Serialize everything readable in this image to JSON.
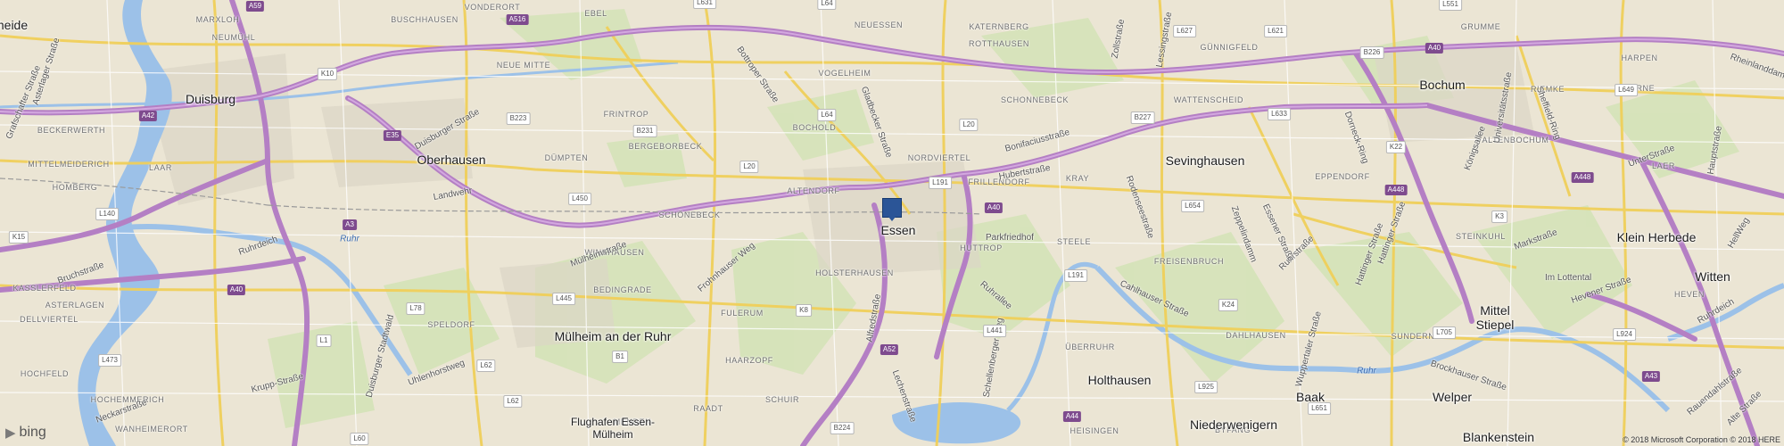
{
  "cities": [
    {
      "id": "duisburg",
      "name": "Duisburg"
    },
    {
      "id": "oberhausen",
      "name": "Oberhausen"
    },
    {
      "id": "essen",
      "name": "Essen"
    },
    {
      "id": "bochum",
      "name": "Bochum"
    },
    {
      "id": "muelheim",
      "name": "Mülheim an der Ruhr"
    },
    {
      "id": "witten",
      "name": "Witten"
    },
    {
      "id": "sevinghausen",
      "name": "Sevinghausen"
    },
    {
      "id": "holthausen",
      "name": "Holthausen"
    },
    {
      "id": "klein-herbede",
      "name": "Klein Herbede"
    },
    {
      "id": "mittel-stiepel",
      "name": "Mittel\nStiepel"
    },
    {
      "id": "welper",
      "name": "Welper"
    },
    {
      "id": "baak",
      "name": "Baak"
    },
    {
      "id": "niederwenigern",
      "name": "Niederwenigern"
    },
    {
      "id": "blankenstein",
      "name": "Blankenstein"
    },
    {
      "id": "flughafen",
      "name": "Flughafen Essen-Mülheim"
    },
    {
      "id": "heide",
      "name": "heide"
    }
  ],
  "districts": [
    "MARXLOH",
    "NEUMÜHL",
    "BUSCHHAUSEN",
    "VONDERORT",
    "EBEL",
    "NEUESSEN",
    "KATERNBERG",
    "ROTTHAUSEN",
    "GÜNNIGFELD",
    "GRUMME",
    "HARPEN",
    "WERNE",
    "NEUE MITTE",
    "VOGELHEIM",
    "SCHONNEBECK",
    "WATTENSCHEID",
    "RIEMKE",
    "BECKERWERTH",
    "FRINTROP",
    "BERGEBORBECK",
    "BOCHOLD",
    "NORDVIERTEL",
    "ALTENBOCHUM",
    "LAAR",
    "MITTELMEIDERICH",
    "DÜMPTEN",
    "ALTENDORF",
    "FRILLENDORF",
    "KRAY",
    "LAER",
    "HOMBERG",
    "SCHÖNEBECK",
    "EPPENDORF",
    "WINKHAUSEN",
    "HOLSTERHAUSEN",
    "HUTTROP",
    "STEELE",
    "KASSLERFELD",
    "STEINKUHL",
    "FREISENBRUCH",
    "ASTERLAGEN",
    "BEDINGRADE",
    "FULERUM",
    "DELLVIERTEL",
    "SPELDORF",
    "DAHLHAUSEN",
    "SUNDERN",
    "HEVEN",
    "HAARZOPF",
    "ÜBERRUHR",
    "HOCHFELD",
    "HOCHEMMERICH",
    "SCHUIR",
    "RAADT",
    "BYFANG",
    "HEISINGEN",
    "WANHEIMERORT",
    "MENDEN"
  ],
  "streets": [
    "Asterlager Straße",
    "Grafschafter Straße",
    "Bottroper Straße",
    "Gladbecker Straße",
    "Duisburger Straße",
    "Frohnhauser Weg",
    "Alfredstraße",
    "Ruhrallee",
    "Rodenseestraße",
    "Zeppelindamm",
    "Ruhrstraße",
    "Hattinger Straße",
    "Cahlhauser Straße",
    "Wuppertaler Straße",
    "Brockhauser Straße",
    "Lechenstraße",
    "Schellenberger Weg",
    "Hubertstraße",
    "Parkfriedhof",
    "Ruhrdeich",
    "Bruchstraße",
    "Landwehr",
    "Mülheimstraße",
    "Duisburger Stadtwald",
    "Uhlenhorstweg",
    "Krupp-Straße",
    "Neckarstraße",
    "Zollstraße",
    "Lessingstraße",
    "Bonifaciusstraße",
    "Essener Straße",
    "Dorneck-Ring",
    "Königsallee",
    "Universitätsstraße",
    "Markstraße",
    "Im Lottental",
    "Sheffield-Ring",
    "Hattinger Straße",
    "UnterStraße",
    "Hauptstraße",
    "HellWeg",
    "Hevener Straße",
    "Ruhrdeich",
    "Rauendahlstraße",
    "Alte Straße",
    "Rheinlanddamm"
  ],
  "shields_hw": [
    "A59",
    "A516",
    "A40",
    "A42",
    "E35",
    "A3",
    "A40",
    "A52",
    "A40",
    "A448",
    "A448",
    "A43",
    "A44"
  ],
  "shields_rd": [
    "K10",
    "B223",
    "B231",
    "L20",
    "L64",
    "L20",
    "L191",
    "L450",
    "L140",
    "K15",
    "L445",
    "L78",
    "L1",
    "L473",
    "L62",
    "L60",
    "L631",
    "L64",
    "L627",
    "L621",
    "L633",
    "B226",
    "L649",
    "L654",
    "K22",
    "K3",
    "K24",
    "L705",
    "L925",
    "L651",
    "B224",
    "L441",
    "L191",
    "B1",
    "K8",
    "L62",
    "L551",
    "B227",
    "L924"
  ],
  "water_labels": [
    "Ruhr",
    "Ruhr"
  ],
  "pin": {
    "label": "Essen location pin",
    "color": "#2b5597"
  },
  "logo": {
    "text": "bing"
  },
  "copyright": "© 2018 Microsoft Corporation © 2018 HERE",
  "colors": {
    "motorway": "#b580c4",
    "major": "#f5d66c",
    "water": "#9cc1e8",
    "land": "#eae4d3",
    "green": "#cfe2b3",
    "urban": "#e2dccc"
  }
}
